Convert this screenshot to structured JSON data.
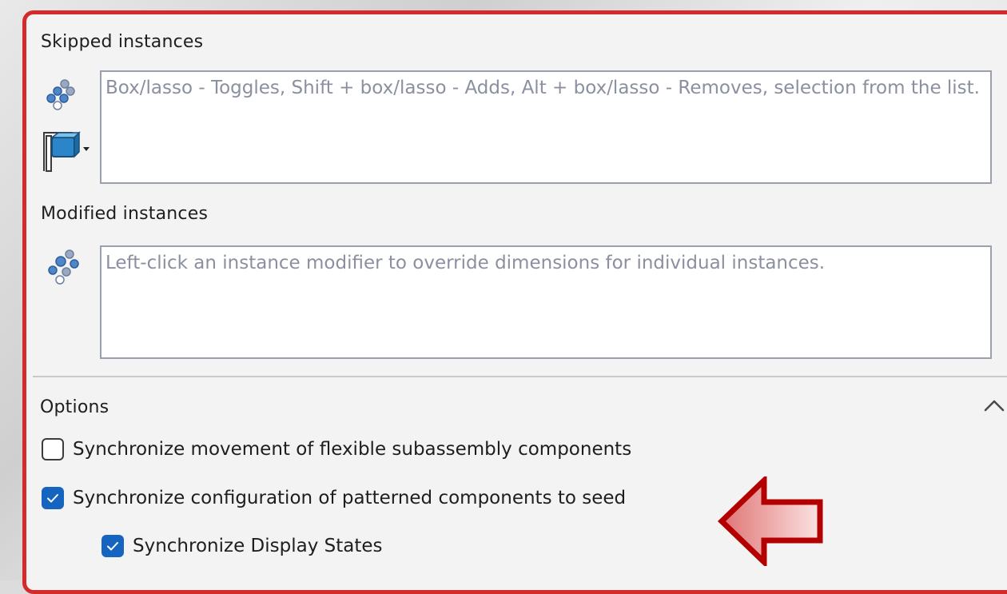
{
  "skipped": {
    "title": "Skipped instances",
    "placeholder": "Box/lasso - Toggles, Shift + box/lasso - Adds, Alt + box/lasso - Removes, selection from the list."
  },
  "modified": {
    "title": "Modified instances",
    "placeholder": "Left-click an instance modifier to override dimensions for individual instances."
  },
  "options": {
    "title": "Options",
    "items": [
      {
        "label": "Synchronize movement of flexible subassembly components",
        "checked": false
      },
      {
        "label": "Synchronize configuration of patterned components to seed",
        "checked": true
      },
      {
        "label": "Synchronize Display States",
        "checked": true
      }
    ]
  },
  "colors": {
    "highlight_border": "#d42a2a",
    "checkbox_accent": "#1565c0",
    "arrow_outline": "#b30000",
    "arrow_fill": "#f2c2c2"
  }
}
